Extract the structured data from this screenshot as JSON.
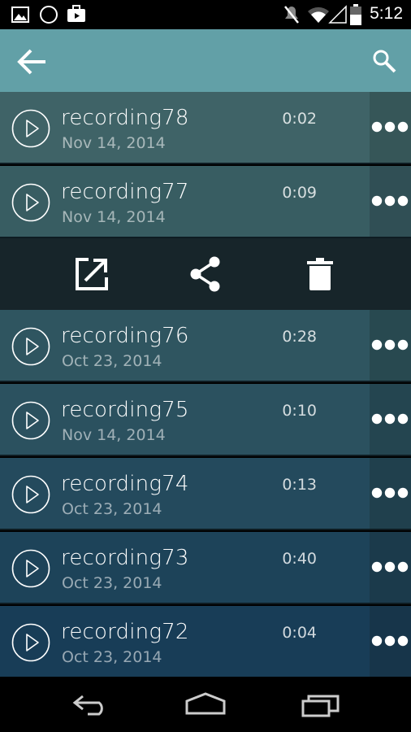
{
  "status_bar": {
    "time": "5:12",
    "icons": [
      "image-icon",
      "circle-icon",
      "briefcase-icon",
      "mute-icon",
      "wifi-icon",
      "signal-icon",
      "battery-icon"
    ]
  },
  "app_bar": {
    "icons": [
      "back-arrow-icon",
      "search-icon"
    ],
    "background": "#62a0a7"
  },
  "recordings": [
    {
      "name": "recording78",
      "date": "Nov 14, 2014",
      "duration": "0:02"
    },
    {
      "name": "recording77",
      "date": "Nov 14, 2014",
      "duration": "0:09"
    },
    {
      "name": "recording76",
      "date": "Oct 23, 2014",
      "duration": "0:28"
    },
    {
      "name": "recording75",
      "date": "Nov 14, 2014",
      "duration": "0:10"
    },
    {
      "name": "recording74",
      "date": "Oct 23, 2014",
      "duration": "0:13"
    },
    {
      "name": "recording73",
      "date": "Oct 23, 2014",
      "duration": "0:40"
    },
    {
      "name": "recording72",
      "date": "Oct 23, 2014",
      "duration": "0:04"
    }
  ],
  "action_bar": {
    "icons": [
      "open-external-icon",
      "share-icon",
      "trash-icon"
    ]
  },
  "nav_bar": {
    "icons": [
      "back-icon",
      "home-icon",
      "recents-icon"
    ]
  }
}
